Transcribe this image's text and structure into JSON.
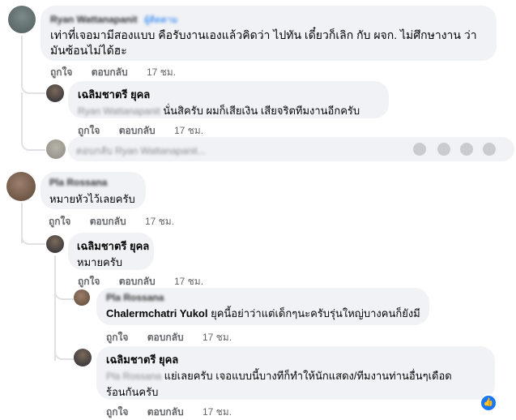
{
  "comments": [
    {
      "author": "Ryan Wattanapanit",
      "author_tag": "ผู้ติดตาม",
      "text": "เท่าที่เจอมามีสองแบบ คือรับงานเองแล้วคิดว่า ไปทัน เดี๋ยวก็เลิก กับ ผจก. ไม่ศึกษางาน ว่ามันซ้อนไม่ได้ฮะ",
      "like": "ถูกใจ",
      "reply": "ตอบกลับ",
      "time": "17 ชม.",
      "replies": [
        {
          "author": "เฉลิมชาตรี ยุคล",
          "mention": "Ryan Wattanapanit",
          "text": "นั่นสิครับ ผมก็เสียเงิน เสียจริตทีมงานอีกครับ",
          "like": "ถูกใจ",
          "reply": "ตอบกลับ",
          "time": "17 ชม."
        }
      ],
      "reply_box_placeholder": "ตอบกลับ Ryan Wattanapanit..."
    },
    {
      "author": "Pla Rossana",
      "text": "หมายหัวไว้เลยครับ",
      "like": "ถูกใจ",
      "reply": "ตอบกลับ",
      "time": "17 ชม.",
      "replies": [
        {
          "author": "เฉลิมชาตรี ยุคล",
          "text": "หมายครับ",
          "like": "ถูกใจ",
          "reply": "ตอบกลับ",
          "time": "17 ชม."
        },
        {
          "author": "Pla Rossana",
          "mention": "Chalermchatri Yukol",
          "text": "ยุคนี้อย่าว่าแต่เด็กๆนะครับรุ่นใหญ่บางคนก็ยังมี",
          "like": "ถูกใจ",
          "reply": "ตอบกลับ",
          "time": "17 ชม."
        },
        {
          "author": "เฉลิมชาตรี ยุคล",
          "mention": "Pla Rossana",
          "text_line1": "แย่เลยครับ เจอแบบนี้บางทีก็ทำให้นักแสดง/ทีมงานท่านอื่นๆเดือด",
          "text_line2": "ร้อนกันครับ",
          "like": "ถูกใจ",
          "reply": "ตอบกลับ",
          "time": "17 ชม.",
          "reaction": "like"
        }
      ]
    }
  ],
  "icons": [
    "emoji-icon",
    "camera-icon",
    "gif-icon",
    "sticker-icon"
  ],
  "colors": {
    "bubble": "#f0f2f5",
    "muted": "#65676b",
    "accent": "#1877f2"
  }
}
